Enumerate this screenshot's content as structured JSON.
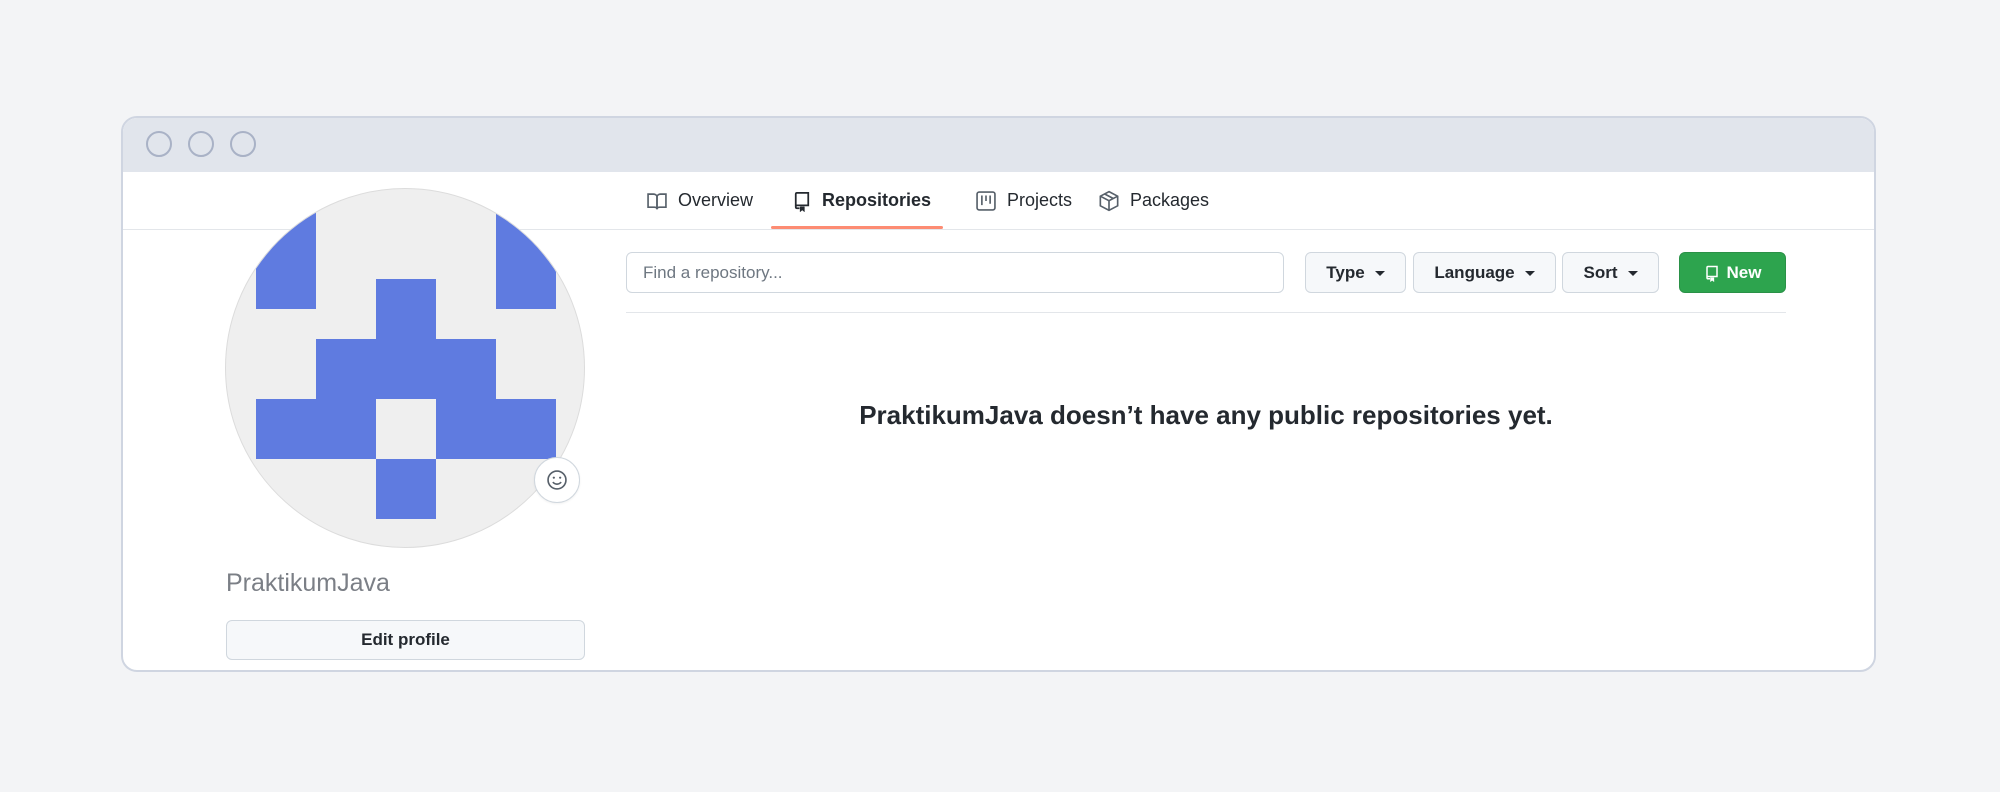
{
  "window": {
    "title_buttons": [
      "close",
      "minimize",
      "maximize"
    ]
  },
  "nav": {
    "tabs": [
      {
        "label": "Overview",
        "icon": "book-icon",
        "active": false
      },
      {
        "label": "Repositories",
        "icon": "repo-icon",
        "active": true
      },
      {
        "label": "Projects",
        "icon": "project-icon",
        "active": false
      },
      {
        "label": "Packages",
        "icon": "package-icon",
        "active": false
      }
    ]
  },
  "profile": {
    "username": "PraktikumJava",
    "edit_label": "Edit profile",
    "status_icon": "smiley-icon",
    "avatar_color": "#5f7be0"
  },
  "repo_toolbar": {
    "search_placeholder": "Find a repository...",
    "type_label": "Type",
    "language_label": "Language",
    "sort_label": "Sort",
    "new_label": "New",
    "new_color": "#2da44e"
  },
  "empty_state": {
    "message": "PraktikumJava doesn’t have any public repositories yet."
  },
  "colors": {
    "tab_underline": "#fd8c73",
    "background": "#f3f4f6"
  }
}
